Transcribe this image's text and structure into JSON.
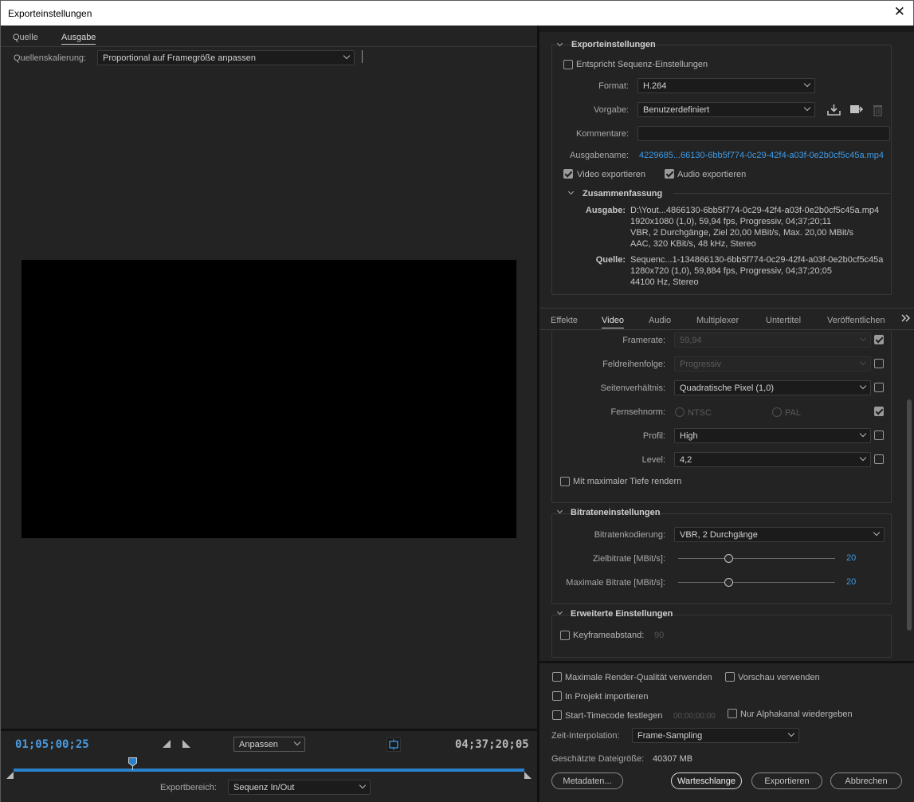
{
  "window": {
    "title": "Exporteinstellungen",
    "close_glyph": "✕"
  },
  "left": {
    "tabs": [
      "Quelle",
      "Ausgabe"
    ],
    "source_scaling": {
      "label": "Quellenskalierung:",
      "value": "Proportional auf Framegröße anpassen"
    },
    "timecode_in": "01;05;00;25",
    "timecode_out": "04;37;20;05",
    "fit": "Anpassen",
    "export_range": {
      "label": "Exportbereich:",
      "value": "Sequenz In/Out"
    }
  },
  "export_settings": {
    "title": "Exporteinstellungen",
    "match_sequence": "Entspricht Sequenz-Einstellungen",
    "format_label": "Format:",
    "format_value": "H.264",
    "preset_label": "Vorgabe:",
    "preset_value": "Benutzerdefiniert",
    "comments_label": "Kommentare:",
    "output_name_label": "Ausgabename:",
    "output_name_value": "4229685...66130-6bb5f774-0c29-42f4-a03f-0e2b0cf5c45a.mp4",
    "export_video": "Video exportieren",
    "export_audio": "Audio exportieren"
  },
  "summary": {
    "title": "Zusammenfassung",
    "output_label": "Ausgabe:",
    "output_lines": [
      "D:\\Yout...4866130-6bb5f774-0c29-42f4-a03f-0e2b0cf5c45a.mp4",
      "1920x1080 (1,0), 59,94 fps, Progressiv, 04;37;20;11",
      "VBR, 2 Durchgänge, Ziel 20,00 MBit/s, Max. 20,00 MBit/s",
      "AAC, 320 KBit/s, 48 kHz, Stereo"
    ],
    "source_label": "Quelle:",
    "source_lines": [
      "Sequenc...1-134866130-6bb5f774-0c29-42f4-a03f-0e2b0cf5c45a",
      "1280x720 (1,0), 59,884 fps, Progressiv, 04;37;20;05",
      "44100 Hz, Stereo"
    ]
  },
  "tabs": [
    "Effekte",
    "Video",
    "Audio",
    "Multiplexer",
    "Untertitel",
    "Veröffentlichen"
  ],
  "video": {
    "framerate": {
      "label": "Framerate:",
      "value": "59,94"
    },
    "field_order": {
      "label": "Feldreihenfolge:",
      "value": "Progressiv"
    },
    "aspect": {
      "label": "Seitenverhältnis:",
      "value": "Quadratische Pixel (1,0)"
    },
    "tv_standard": {
      "label": "Fernsehnorm:",
      "ntsc": "NTSC",
      "pal": "PAL"
    },
    "profile": {
      "label": "Profil:",
      "value": "High"
    },
    "level": {
      "label": "Level:",
      "value": "4,2"
    },
    "max_depth": "Mit maximaler Tiefe rendern"
  },
  "bitrate": {
    "title": "Bitrateneinstellungen",
    "encoding_label": "Bitratenkodierung:",
    "encoding_value": "VBR, 2 Durchgänge",
    "target_label": "Zielbitrate [MBit/s]:",
    "target_value": "20",
    "max_label": "Maximale Bitrate [MBit/s]:",
    "max_value": "20"
  },
  "advanced": {
    "title": "Erweiterte Einstellungen",
    "keyframe_label": "Keyframeabstand:",
    "keyframe_value": "90"
  },
  "options": {
    "max_render_quality": "Maximale Render-Qualität verwenden",
    "use_previews": "Vorschau verwenden",
    "import_into_project": "In Projekt importieren",
    "set_start_timecode": "Start-Timecode festlegen",
    "start_timecode_value": "00;00;00;00",
    "alpha_only": "Nur Alphakanal wiedergeben",
    "time_interpolation_label": "Zeit-Interpolation:",
    "time_interpolation_value": "Frame-Sampling",
    "file_size_label": "Geschätzte Dateigröße:",
    "file_size_value": "40307 MB"
  },
  "buttons": {
    "metadata": "Metadaten...",
    "queue": "Warteschlange",
    "export": "Exportieren",
    "cancel": "Abbrechen"
  },
  "icons": [
    "save-preset-icon",
    "import-preset-icon",
    "delete-preset-icon",
    "chevron-double-right-icon",
    "mark-in-icon",
    "mark-out-icon",
    "safe-margins-icon"
  ]
}
